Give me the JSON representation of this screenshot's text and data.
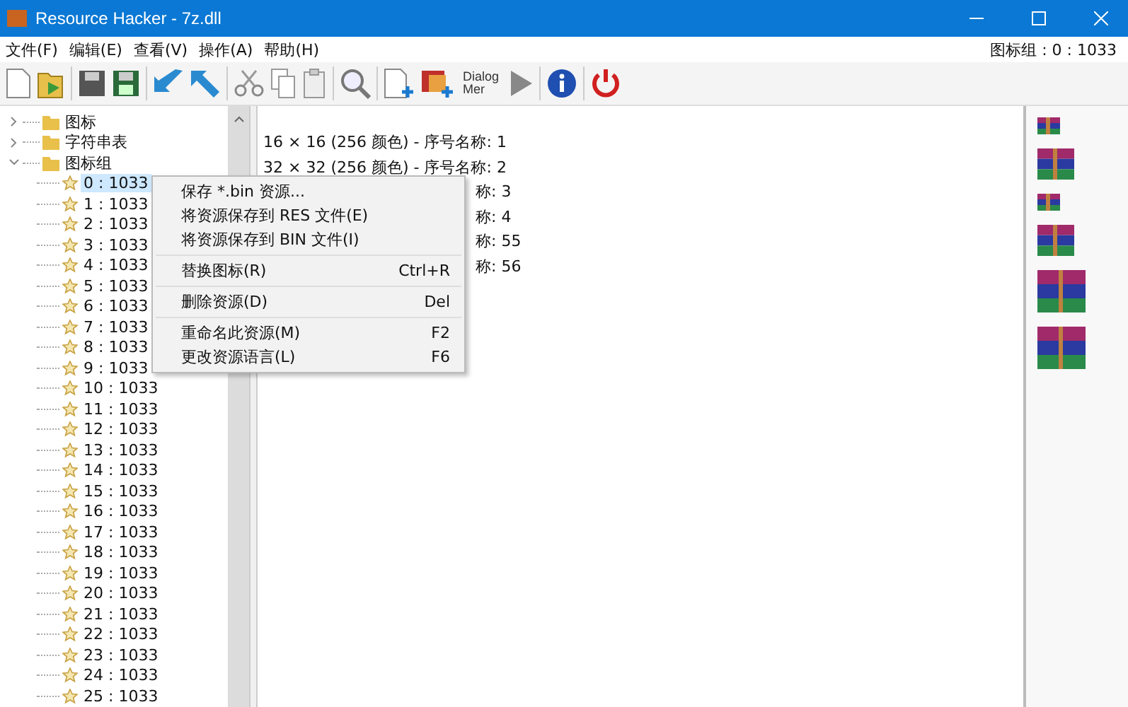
{
  "window": {
    "title": "Resource Hacker - 7z.dll"
  },
  "menu": [
    "文件(F)",
    "编辑(E)",
    "查看(V)",
    "操作(A)",
    "帮助(H)"
  ],
  "status": "图标组 : 0 : 1033",
  "toolbar": {
    "dialog_button": [
      "Dialog",
      "Mer"
    ]
  },
  "tree": [
    {
      "label": "图标",
      "expanded": false
    },
    {
      "label": "字符串表",
      "expanded": false
    },
    {
      "label": "图标组",
      "expanded": true,
      "children": [
        {
          "label": "0 : 1033",
          "selected": true
        },
        {
          "label": "1 : 1033",
          "selected": false
        },
        {
          "label": "2 : 1033",
          "selected": false
        },
        {
          "label": "3 : 1033",
          "selected": false
        },
        {
          "label": "4 : 1033",
          "selected": false
        },
        {
          "label": "5 : 1033",
          "selected": false
        },
        {
          "label": "6 : 1033",
          "selected": false
        },
        {
          "label": "7 : 1033",
          "selected": false
        },
        {
          "label": "8 : 1033",
          "selected": false
        },
        {
          "label": "9 : 1033",
          "selected": false
        },
        {
          "label": "10 : 1033",
          "selected": false
        },
        {
          "label": "11 : 1033",
          "selected": false
        },
        {
          "label": "12 : 1033",
          "selected": false
        },
        {
          "label": "13 : 1033",
          "selected": false
        },
        {
          "label": "14 : 1033",
          "selected": false
        },
        {
          "label": "15 : 1033",
          "selected": false
        },
        {
          "label": "16 : 1033",
          "selected": false
        },
        {
          "label": "17 : 1033",
          "selected": false
        },
        {
          "label": "18 : 1033",
          "selected": false
        },
        {
          "label": "19 : 1033",
          "selected": false
        },
        {
          "label": "20 : 1033",
          "selected": false
        },
        {
          "label": "21 : 1033",
          "selected": false
        },
        {
          "label": "22 : 1033",
          "selected": false
        },
        {
          "label": "23 : 1033",
          "selected": false
        },
        {
          "label": "24 : 1033",
          "selected": false
        },
        {
          "label": "25 : 1033",
          "selected": false
        }
      ]
    }
  ],
  "content_lines": [
    {
      "kind": "full",
      "text": "16 × 16 (256 颜色)  -  序号名称: 1"
    },
    {
      "kind": "full",
      "text": "32 × 32 (256 颜色)  -  序号名称: 2"
    },
    {
      "kind": "partial",
      "text": "称: 3"
    },
    {
      "kind": "partial",
      "text": "称: 4"
    },
    {
      "kind": "partial",
      "text": "称: 55"
    },
    {
      "kind": "partial",
      "text": "称: 56"
    }
  ],
  "context_menu": [
    [
      {
        "label": "保存 *.bin 资源..."
      },
      {
        "label": "将资源保存到 RES 文件(E)"
      },
      {
        "label": "将资源保存到 BIN 文件(I)"
      }
    ],
    [
      {
        "label": "替换图标(R)",
        "shortcut": "Ctrl+R"
      }
    ],
    [
      {
        "label": "删除资源(D)",
        "shortcut": "Del"
      }
    ],
    [
      {
        "label": "重命名此资源(M)",
        "shortcut": "F2"
      },
      {
        "label": "更改资源语言(L)",
        "shortcut": "F6"
      }
    ]
  ]
}
